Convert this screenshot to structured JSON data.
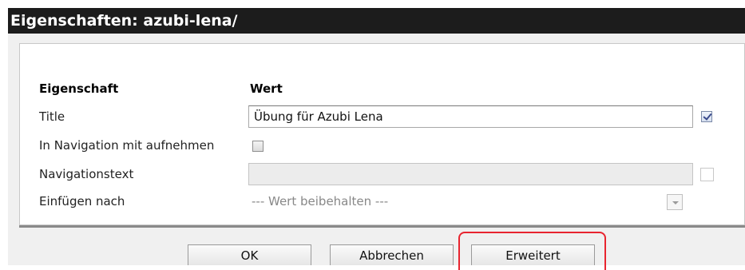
{
  "window": {
    "title": "Eigenschaften: azubi-lena/"
  },
  "table": {
    "col_property": "Eigenschaft",
    "col_value": "Wert",
    "rows": [
      {
        "label": "Title",
        "value": "Übung für Azubi Lena",
        "checked": true
      },
      {
        "label": "In Navigation mit aufnehmen",
        "checked": false
      },
      {
        "label": "Navigationstext",
        "value": "",
        "disabled": true,
        "checked": false
      },
      {
        "label": "Einfügen nach",
        "value": "--- Wert beibehalten ---",
        "disabled": true
      }
    ]
  },
  "buttons": {
    "ok": "OK",
    "cancel": "Abbrechen",
    "advanced": "Erweitert"
  },
  "colors": {
    "titlebar": "#1c1c1c",
    "highlight": "#e8242f",
    "dialog_bg": "#f0f0f0"
  }
}
